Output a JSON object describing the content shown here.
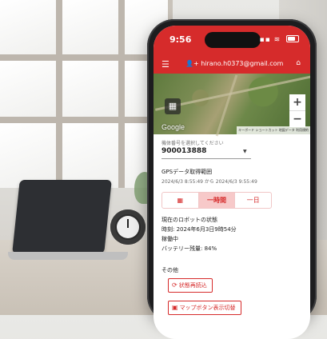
{
  "status_bar": {
    "time": "9:56",
    "icons": "▪▪ ≋"
  },
  "app_bar": {
    "account": "hirano.h0373@gmail.com",
    "menu_icon": "menu-icon",
    "account_icon": "person-add-icon",
    "home_icon": "home-icon"
  },
  "map": {
    "layer_icon": "layers-icon",
    "zoom_in": "+",
    "zoom_out": "−",
    "logo": "Google",
    "footer": "キーボード ショートカット  地図データ  利用規約"
  },
  "device_select": {
    "label": "機体番号を選択してください",
    "value": "900013888"
  },
  "gps": {
    "title": "GPSデータ取得範囲",
    "range": "2024/6/3 8:55:49 から 2024/6/3 9:55:49",
    "segments": [
      {
        "label": "",
        "icon": "calendar-icon"
      },
      {
        "label": "一時間"
      },
      {
        "label": "一日"
      }
    ],
    "selected": "一時間"
  },
  "robot_status": {
    "title": "現在のロボットの状態",
    "time": "時刻: 2024年6月3日9時54分",
    "state": "稼働中",
    "battery": "バッテリー残量: 84%"
  },
  "other": {
    "title": "その他",
    "reload_button": "状態再読込",
    "toggle_button": "マップボタン表示切替"
  },
  "colors": {
    "accent": "#d62b2b",
    "segment_active": "#f7c9c9"
  }
}
